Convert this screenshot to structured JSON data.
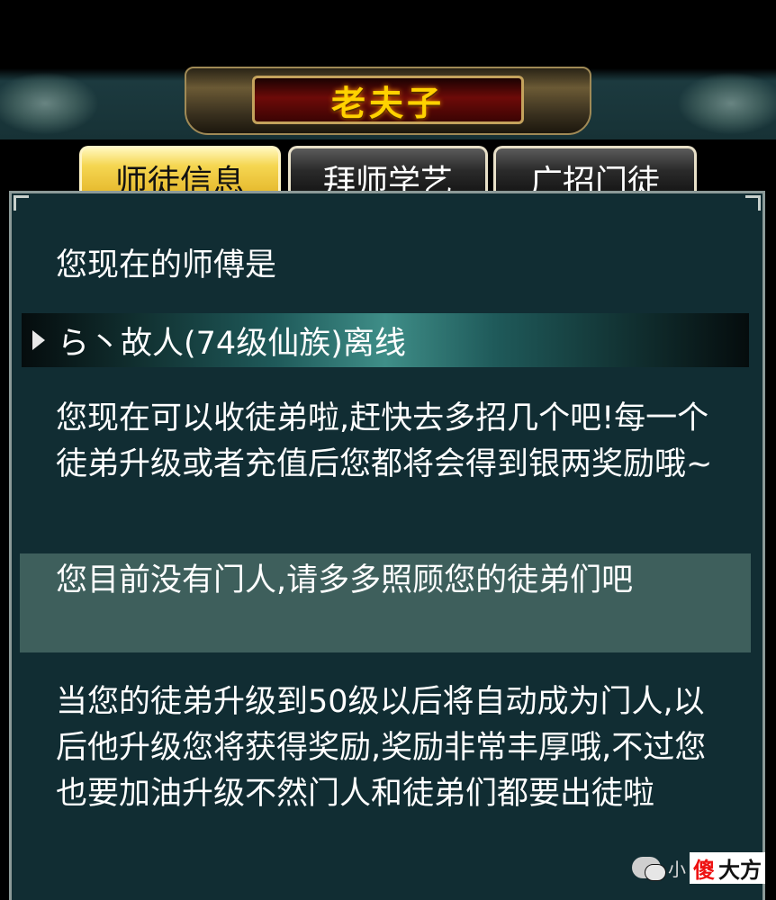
{
  "header": {
    "title": "老夫子"
  },
  "tabs": [
    {
      "label": "师徒信息",
      "active": true
    },
    {
      "label": "拜师学艺",
      "active": false
    },
    {
      "label": "广招门徒",
      "active": false
    }
  ],
  "panel": {
    "master_label": "您现在的师傅是",
    "master_entry": "ら丶故人(74级仙族)离线",
    "recruit_text": "您现在可以收徒弟啦,赶快去多招几个吧!每一个徒弟升级或者充值后您都将会得到银两奖励哦~",
    "notice_text": "您目前没有门人,请多多照顾您的徒弟们吧",
    "info_text": "当您的徒弟升级到50级以后将自动成为门人,以后他升级您将获得奖励,奖励非常丰厚哦,不过您也要加油升级不然门人和徒弟们都要出徒啦"
  },
  "watermark": {
    "prefix": "小",
    "highlight": "傻",
    "suffix": "大方"
  },
  "colors": {
    "title_text": "#ffd200",
    "panel_bg": "#112d33",
    "active_tab": "#f5d651",
    "notice_bg": "#3e5f5c"
  }
}
